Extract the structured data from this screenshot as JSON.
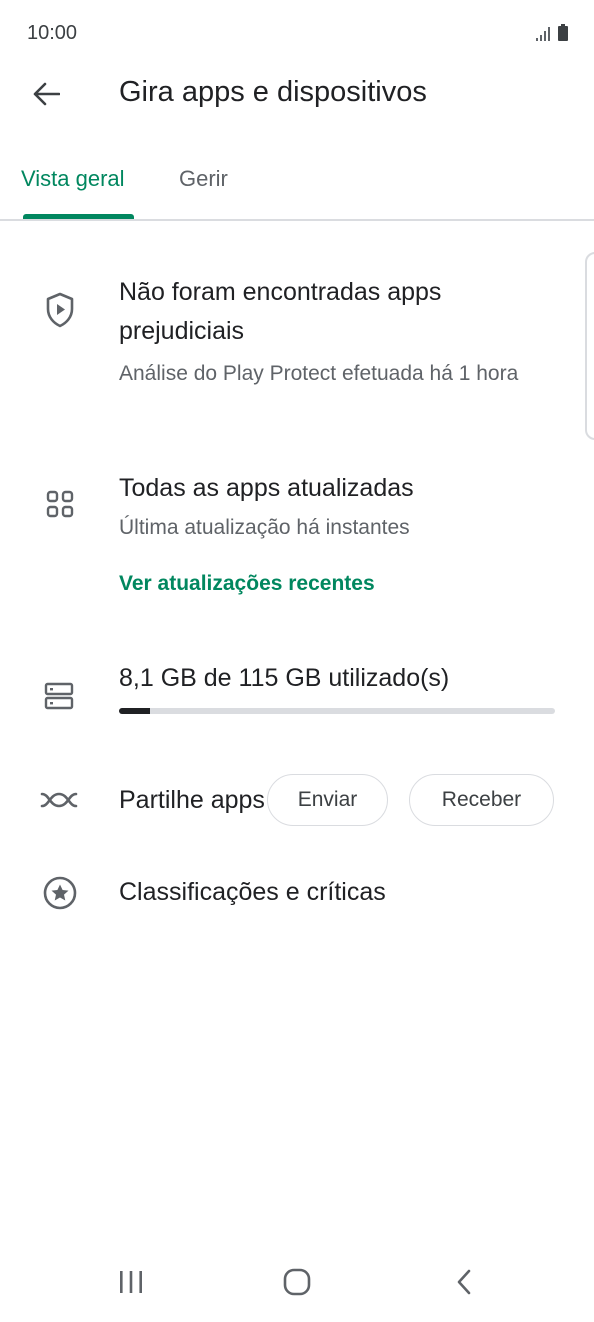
{
  "status_bar": {
    "time": "10:00",
    "icons": [
      "signal-icon",
      "battery-icon"
    ]
  },
  "header": {
    "title": "Gira apps e dispositivos",
    "back_icon": "arrow-back-icon"
  },
  "tabs": [
    {
      "label": "Vista geral",
      "selected": true
    },
    {
      "label": "Gerir",
      "selected": false
    }
  ],
  "protect": {
    "icon": "play-protect-shield-icon",
    "title": "Não foram encontradas apps prejudiciais",
    "subtitle": "Análise do Play Protect efetuada há 1 hora"
  },
  "updates": {
    "icon": "apps-grid-icon",
    "title": "Todas as apps atualizadas",
    "subtitle": "Última atualização há instantes",
    "link": "Ver atualizações recentes"
  },
  "storage": {
    "icon": "storage-icon",
    "label": "8,1 GB de 115 GB utilizado(s)",
    "used_fraction": 0.07
  },
  "share": {
    "icon": "share-apps-icon",
    "label": "Partilhe apps",
    "send_label": "Enviar",
    "receive_label": "Receber"
  },
  "ratings": {
    "icon": "star-circle-icon",
    "label": "Classificações e críticas"
  },
  "colors": {
    "accent": "#01875f",
    "text": "#202124",
    "secondary": "#5f6368",
    "divider": "#dadce0"
  },
  "nav_bar": {
    "icons": [
      "recent-apps-icon",
      "home-icon",
      "back-icon"
    ]
  }
}
